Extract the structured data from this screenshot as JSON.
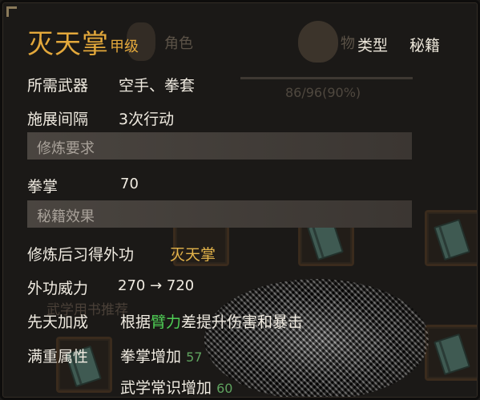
{
  "background": {
    "tab_ghost_1": "角色",
    "tab_ghost_2": "物",
    "progress_text": "86/96(90%)",
    "ghost_left_text": "武学用书推荐"
  },
  "tooltip": {
    "title": "灭天掌",
    "grade": "甲级",
    "type_label": "类型",
    "type_value": "秘籍",
    "weapon": {
      "label": "所需武器",
      "value": "空手、拳套"
    },
    "interval": {
      "label": "施展间隔",
      "value": "3次行动"
    },
    "section_requirements": "修炼要求",
    "requirement": {
      "label": "拳掌",
      "value": "70"
    },
    "section_effects": "秘籍效果",
    "learn": {
      "label": "修炼后习得外功",
      "value": "灭天掌"
    },
    "power": {
      "label": "外功威力",
      "value": "270 → 720"
    },
    "innate": {
      "label": "先天加成",
      "prefix": "根据",
      "highlight": "臂力",
      "suffix": "差提升伤害和暴击"
    },
    "full_attr": {
      "label": "满重属性",
      "line1_name": "拳掌增加",
      "line1_value": "57",
      "line2_name": "武学常识增加",
      "line2_value": "60"
    }
  },
  "colors": {
    "gold": "#e3a83b",
    "green": "#4fcf55",
    "text": "#f0ebe1",
    "section_bg": "#4a4540"
  }
}
